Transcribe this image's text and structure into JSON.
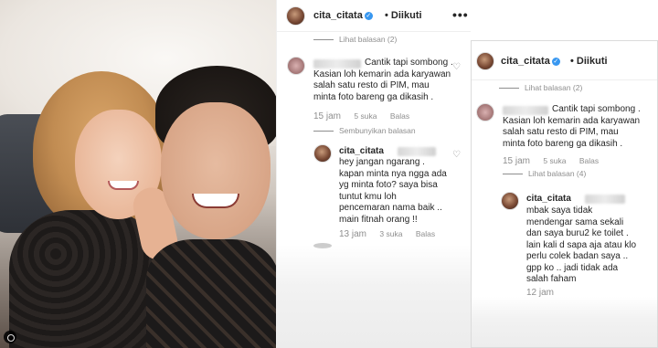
{
  "post": {
    "username": "cita_citata",
    "follow_label": "Diikuti",
    "more_label": "•••",
    "verified_label": "✓"
  },
  "panel1": {
    "view_replies_top": "Lihat balasan (2)",
    "comment": {
      "text": "Cantik tapi sombong .\nKasian loh kemarin ada karyawan\nsalah satu resto di PIM, mau\nminta foto bareng ga dikasih .",
      "time": "15 jam",
      "likes": "5 suka",
      "reply_label": "Balas"
    },
    "hide_replies": "Sembunyikan balasan",
    "reply": {
      "username": "cita_citata",
      "text": "hey jangan ngarang .\nkapan minta nya ngga ada\nyg minta foto? saya bisa\ntuntut kmu loh\npencemaran nama baik ..\nmain fitnah orang !!",
      "time": "13 jam",
      "likes": "3 suka",
      "reply_label": "Balas"
    }
  },
  "panel2": {
    "username": "cita_citata",
    "follow_label": "Diikuti",
    "view_replies_top": "Lihat balasan (2)",
    "comment": {
      "text": "Cantik tapi sombong .\nKasian loh kemarin ada karyawan\nsalah satu resto di PIM, mau\nminta foto bareng ga dikasih .",
      "time": "15 jam",
      "likes": "5 suka",
      "reply_label": "Balas"
    },
    "view_replies": "Lihat balasan (4)",
    "reply": {
      "username": "cita_citata",
      "text": "mbak saya tidak\nmendengar sama sekali\ndan saya buru2 ke toilet .\nlain kali d sapa aja atau klo\nperlu colek badan saya ..\ngpp ko .. jadi tidak ada\nsalah faham",
      "time": "12 jam"
    }
  },
  "colors": {
    "verified": "#3897f0",
    "muted_text": "#8e8e8e",
    "text": "#262626"
  }
}
